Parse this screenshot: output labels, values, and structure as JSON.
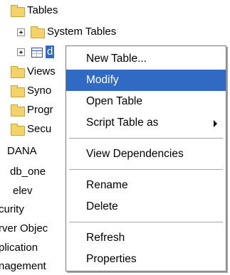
{
  "tree": {
    "tables": {
      "label": "Tables"
    },
    "system_tables": {
      "label": "System Tables"
    },
    "selected_table": {
      "label": "d"
    },
    "views": {
      "label": "Views"
    },
    "synonyms": {
      "label": "Syno"
    },
    "programmability": {
      "label": "Progr"
    },
    "security": {
      "label": "Secu"
    },
    "dana": {
      "label": "DANA"
    },
    "db_one": {
      "label": "db_one"
    },
    "elev": {
      "label": "elev"
    },
    "curity": {
      "label": "curity"
    },
    "server_objects": {
      "label": "rver Objec"
    },
    "replication": {
      "label": "plication"
    },
    "management": {
      "label": "nagement"
    }
  },
  "context_menu": {
    "new_table": "New Table...",
    "modify": "Modify",
    "open_table": "Open Table",
    "script_table_as": "Script Table as",
    "view_dependencies": "View Dependencies",
    "rename": "Rename",
    "delete": "Delete",
    "refresh": "Refresh",
    "properties": "Properties",
    "highlighted_item": "Modify"
  },
  "colors": {
    "selection": "#316ac5",
    "folder": "#f4d26a"
  }
}
